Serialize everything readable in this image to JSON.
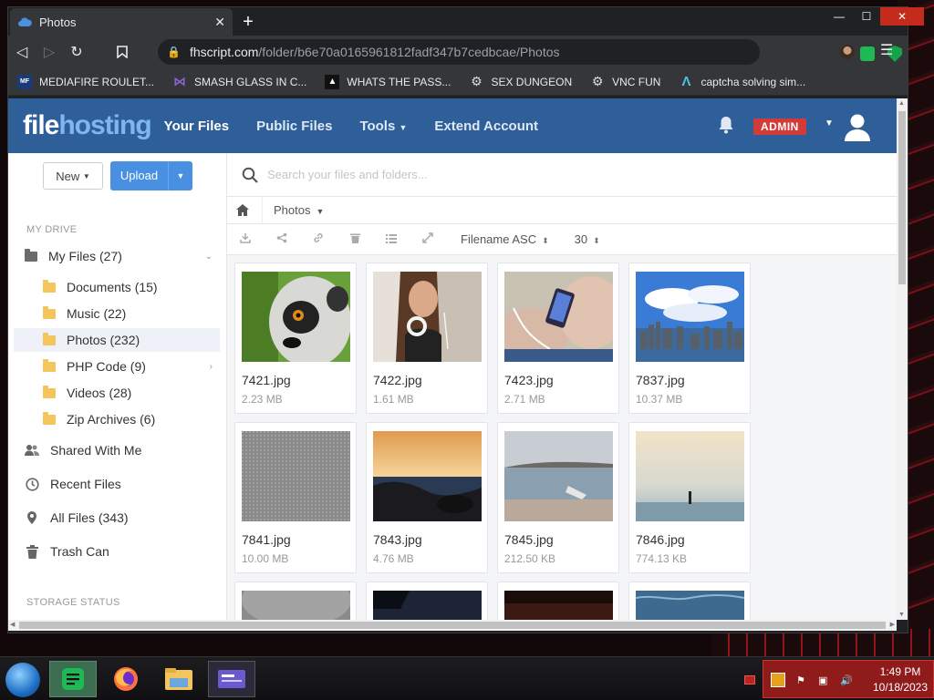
{
  "browser": {
    "tab_title": "Photos",
    "url_domain": "fhscript.com",
    "url_path": "/folder/b6e70a0165961812fadf347b7cedbcae/Photos",
    "bookmarks": [
      {
        "label": "MEDIAFIRE ROULET...",
        "icon": "mediafire-icon"
      },
      {
        "label": "SMASH GLASS IN C...",
        "icon": "visual-studio-icon"
      },
      {
        "label": "WHATS THE PASS...",
        "icon": "warning-icon"
      },
      {
        "label": "SEX DUNGEON",
        "icon": "gear-icon"
      },
      {
        "label": "VNC FUN",
        "icon": "gear-icon"
      },
      {
        "label": "captcha solving sim...",
        "icon": "lambda-icon"
      }
    ]
  },
  "site": {
    "logo_a": "file",
    "logo_b": "hosting",
    "nav": [
      "Your Files",
      "Public Files",
      "Tools",
      "Extend Account"
    ],
    "admin_badge": "ADMIN"
  },
  "sidebar": {
    "new_label": "New",
    "upload_label": "Upload",
    "my_drive_header": "MY DRIVE",
    "my_files": "My Files (27)",
    "folders": [
      {
        "label": "Documents (15)",
        "active": false,
        "has_children": false
      },
      {
        "label": "Music (22)",
        "active": false,
        "has_children": false
      },
      {
        "label": "Photos (232)",
        "active": true,
        "has_children": false
      },
      {
        "label": "PHP Code (9)",
        "active": false,
        "has_children": true
      },
      {
        "label": "Videos (28)",
        "active": false,
        "has_children": false
      },
      {
        "label": "Zip Archives (6)",
        "active": false,
        "has_children": false
      }
    ],
    "shared": "Shared With Me",
    "recent": "Recent Files",
    "all_files": "All Files (343)",
    "trash": "Trash Can",
    "storage_header": "STORAGE STATUS"
  },
  "main": {
    "search_placeholder": "Search your files and folders...",
    "breadcrumb_current": "Photos",
    "sort_label": "Filename ASC",
    "per_page": "30",
    "files": [
      {
        "name": "7421.jpg",
        "size": "2.23 MB",
        "thumb": "lemur"
      },
      {
        "name": "7422.jpg",
        "size": "1.61 MB",
        "thumb": "woman-headphones"
      },
      {
        "name": "7423.jpg",
        "size": "2.71 MB",
        "thumb": "phone-hands"
      },
      {
        "name": "7837.jpg",
        "size": "10.37 MB",
        "thumb": "city-skyline"
      },
      {
        "name": "7841.jpg",
        "size": "10.00 MB",
        "thumb": "grey-texture"
      },
      {
        "name": "7843.jpg",
        "size": "4.76 MB",
        "thumb": "sunset-rocks"
      },
      {
        "name": "7845.jpg",
        "size": "212.50 KB",
        "thumb": "harbor"
      },
      {
        "name": "7846.jpg",
        "size": "774.13 KB",
        "thumb": "calm-sea"
      },
      {
        "name": "",
        "size": "",
        "thumb": "grey-blur"
      },
      {
        "name": "",
        "size": "",
        "thumb": "dark-night"
      },
      {
        "name": "",
        "size": "",
        "thumb": "dark-red"
      },
      {
        "name": "",
        "size": "",
        "thumb": "ocean"
      }
    ]
  },
  "taskbar": {
    "time": "1:49 PM",
    "date": "10/18/2023"
  },
  "colors": {
    "brand_blue": "#2e5f99",
    "upload_blue": "#4a90e2",
    "admin_red": "#d33b3b",
    "folder_yellow": "#f3c55a"
  }
}
